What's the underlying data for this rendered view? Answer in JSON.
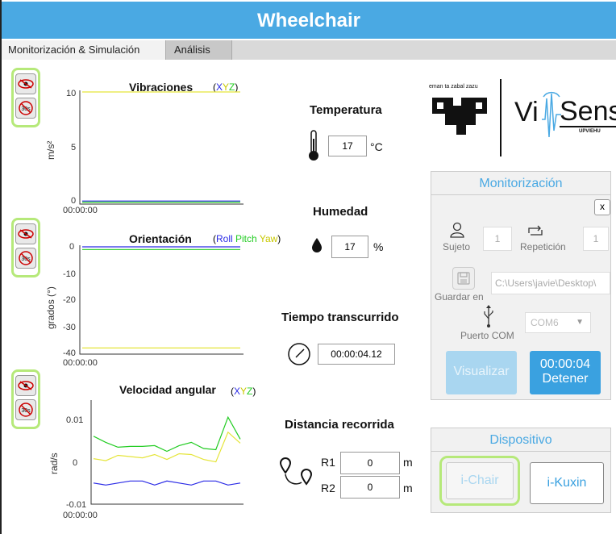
{
  "app_title": "Wheelchair",
  "tabs": [
    {
      "label": "Monitorización & Simulación",
      "active": true
    },
    {
      "label": "Análisis",
      "active": false
    }
  ],
  "plots": {
    "vibraciones": {
      "title": "Vibraciones",
      "key": [
        "X",
        "Y",
        "Z"
      ],
      "ylabel": "m/s²",
      "yticks": [
        "10",
        "5",
        "0"
      ],
      "xtick": "00:00:00"
    },
    "orientacion": {
      "title": "Orientación",
      "key": [
        "Roll",
        "Pitch",
        "Yaw"
      ],
      "ylabel": "grados (°)",
      "yticks": [
        "0",
        "-10",
        "-20",
        "-30",
        "-40"
      ],
      "xtick": "00:00:00"
    },
    "velocidad": {
      "title": "Velocidad angular",
      "key": [
        "X",
        "Y",
        "Z"
      ],
      "ylabel": "rad/s",
      "yticks": [
        "0.01",
        "0",
        "-0.01"
      ],
      "xtick": "00:00:00"
    }
  },
  "sensors": {
    "temperatura": {
      "title": "Temperatura",
      "value": "17",
      "unit": "°C"
    },
    "humedad": {
      "title": "Humedad",
      "value": "17",
      "unit": "%"
    },
    "tiempo": {
      "title": "Tiempo transcurrido",
      "value": "00:00:04.12"
    },
    "distancia": {
      "title": "Distancia recorrida",
      "r1_label": "R1",
      "r1_value": "0",
      "r2_label": "R2",
      "r2_value": "0",
      "unit": "m"
    }
  },
  "logos": {
    "ehu_text": "eman ta zabal zazu",
    "visens_vi": "Vi",
    "visens_sens": "Sens",
    "visens_sub": "UPV/EHU"
  },
  "monitorizacion": {
    "title": "Monitorización",
    "close_label": "x",
    "sujeto_label": "Sujeto",
    "sujeto_value": "1",
    "repeticion_label": "Repetición",
    "repeticion_value": "1",
    "guardar_label": "Guardar en",
    "path_value": "C:\\Users\\javie\\Desktop\\",
    "puerto_label": "Puerto COM",
    "puerto_value": "COM6",
    "visualizar_label": "Visualizar",
    "timer_label": "00:00:04",
    "detener_label": "Detener"
  },
  "dispositivo": {
    "title": "Dispositivo",
    "ichair_label": "i-Chair",
    "ikuxin_label": "i-Kuxin"
  },
  "colors": {
    "accent": "#4aa9e3",
    "highlight": "#b6e97a",
    "x": "#2a2ae6",
    "y": "#e5e53a",
    "z": "#22cc22"
  },
  "chart_data": [
    {
      "type": "line",
      "title": "Vibraciones",
      "ylabel": "m/s²",
      "ylim": [
        0,
        10
      ],
      "series": [
        {
          "name": "X",
          "color": "#2a2ae6",
          "values": [
            0.2,
            0.2,
            0.2,
            0.2,
            0.2,
            0.2,
            0.2,
            0.2,
            0.2,
            0.2
          ]
        },
        {
          "name": "Y",
          "color": "#e5e53a",
          "values": [
            10,
            10,
            10,
            10,
            10,
            10,
            10,
            10,
            10,
            10
          ]
        },
        {
          "name": "Z",
          "color": "#22cc22",
          "values": [
            0.1,
            0.1,
            0.1,
            0.1,
            0.1,
            0.1,
            0.1,
            0.1,
            0.1,
            0.1
          ]
        }
      ]
    },
    {
      "type": "line",
      "title": "Orientación",
      "ylabel": "grados (°)",
      "ylim": [
        -40,
        0
      ],
      "series": [
        {
          "name": "Roll",
          "color": "#2a2ae6",
          "values": [
            0,
            0,
            0,
            0,
            0,
            0,
            0,
            0,
            0,
            0
          ]
        },
        {
          "name": "Pitch",
          "color": "#22cc22",
          "values": [
            -1,
            -1,
            -1,
            -1,
            -1,
            -1,
            -1,
            -1,
            -1,
            -1
          ]
        },
        {
          "name": "Yaw",
          "color": "#e5e53a",
          "values": [
            -38,
            -38,
            -38,
            -38,
            -38,
            -38,
            -38,
            -38,
            -38,
            -38
          ]
        }
      ]
    },
    {
      "type": "line",
      "title": "Velocidad angular",
      "ylabel": "rad/s",
      "ylim": [
        -0.01,
        0.015
      ],
      "series": [
        {
          "name": "X",
          "color": "#2a2ae6",
          "values": [
            -0.005,
            -0.0055,
            -0.005,
            -0.0045,
            -0.0045,
            -0.0055,
            -0.0045,
            -0.005,
            -0.0055,
            -0.0045,
            -0.0045,
            -0.0055,
            -0.005
          ]
        },
        {
          "name": "Y",
          "color": "#e5e53a",
          "values": [
            0.001,
            0.0005,
            0.0018,
            0.0015,
            0.0012,
            0.002,
            0.0008,
            0.0022,
            0.002,
            0.0008,
            0.0002,
            0.0075,
            0.0048
          ]
        },
        {
          "name": "Z",
          "color": "#22cc22",
          "values": [
            0.0065,
            0.005,
            0.0038,
            0.004,
            0.004,
            0.0042,
            0.0028,
            0.0042,
            0.005,
            0.0035,
            0.0032,
            0.0112,
            0.0058
          ]
        }
      ]
    }
  ]
}
